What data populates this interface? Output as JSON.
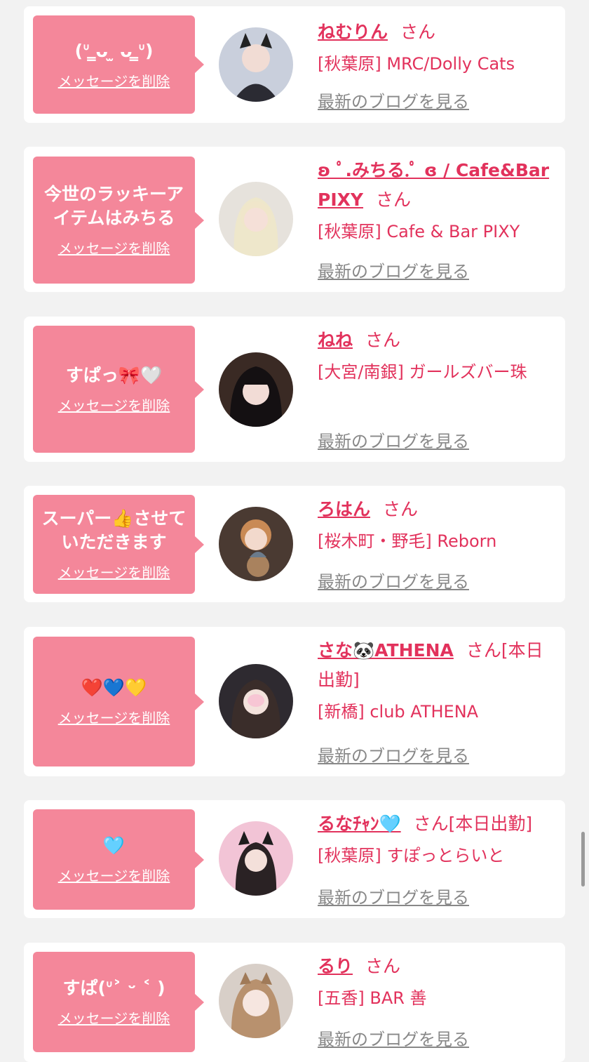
{
  "delete_label": "メッセージを削除",
  "blog_label": "最新のブログを見る",
  "san": "さん",
  "colors": {
    "accent": "#e2325c",
    "bubble": "#f4879a",
    "blog_link": "#888888",
    "background": "#f2f2f2"
  },
  "messages": [
    {
      "text": "(ᐡ ̳ᴗ ̫ ᴗ ̳ᐡ)",
      "name": "ねむりん",
      "suffix": "",
      "shop": "[秋葉原] MRC/Dolly Cats",
      "avatar": "avatar-photo"
    },
    {
      "text": "今世のラッキーアイテムはみちる",
      "name": "ʚ ﾟ.みちる.ﾟ ɞ / Cafe&Bar PIXY",
      "suffix": "",
      "shop": "[秋葉原] Cafe & Bar PIXY",
      "avatar": "avatar-photo"
    },
    {
      "text": "すぱっ🎀🤍",
      "name": "ねね",
      "suffix": "",
      "shop": "[大宮/南銀] ガールズバー珠",
      "avatar": "avatar-photo"
    },
    {
      "text": "スーパー👍させていただきます",
      "name": "ろはん",
      "suffix": "",
      "shop": "[桜木町・野毛] Reborn",
      "avatar": "avatar-photo"
    },
    {
      "text": "❤️💙💛",
      "name": "さな🐼ATHENA",
      "suffix": "[本日出勤]",
      "shop": "[新橋] club ATHENA",
      "avatar": "avatar-photo"
    },
    {
      "text": "🩵",
      "name": "るなﾁｬﾝ🩵",
      "suffix": "[本日出勤]",
      "shop": "[秋葉原] すぽっとらいと",
      "avatar": "avatar-photo"
    },
    {
      "text": "すぱ(ᐡ˃ ᵕ ˂ )",
      "name": "るり",
      "suffix": "",
      "shop": "[五香] BAR 善",
      "avatar": "avatar-photo"
    }
  ]
}
